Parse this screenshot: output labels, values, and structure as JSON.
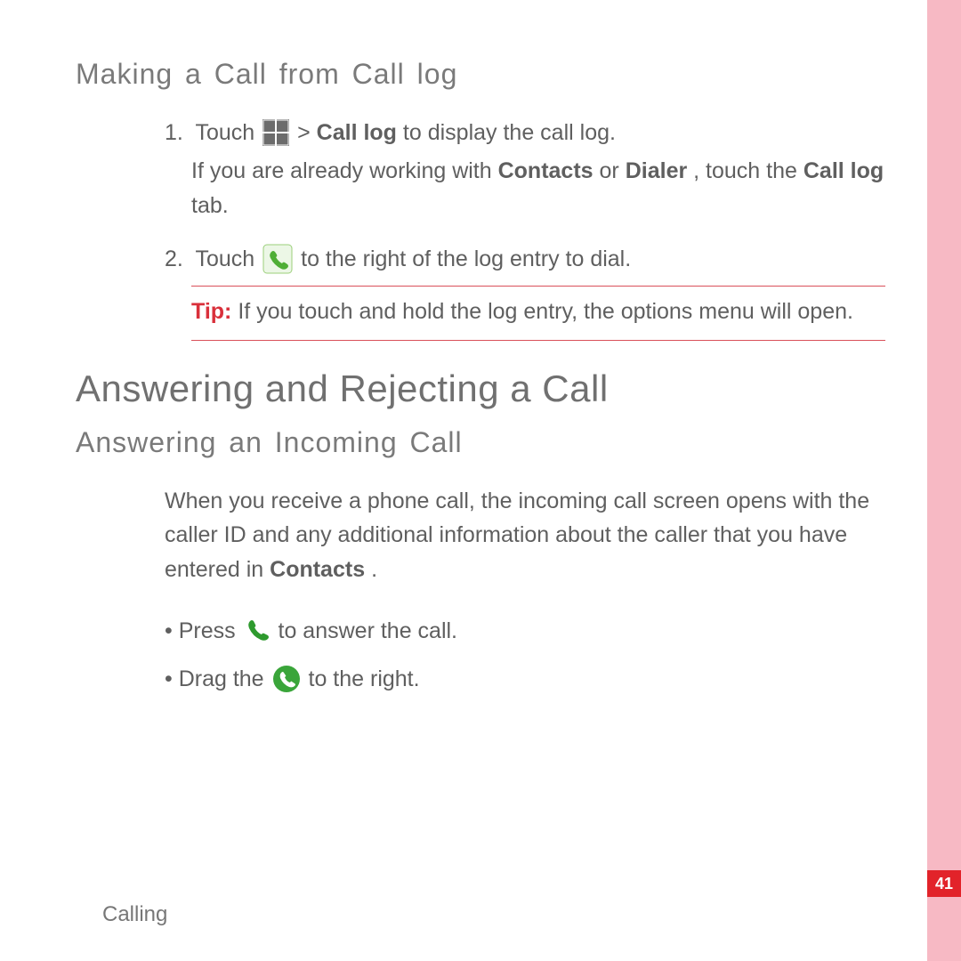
{
  "section1": {
    "title": "Making a Call from Call log",
    "step1_prefix": "1.",
    "step1_a": "Touch ",
    "step1_b": " > ",
    "step1_bold": "Call log",
    "step1_c": " to display the call log.",
    "step1_sub_a": "If you are already working with ",
    "step1_sub_bold1": "Contacts",
    "step1_sub_b": " or ",
    "step1_sub_bold2": "Dialer",
    "step1_sub_c": ", touch the ",
    "step1_sub_bold3": "Call log",
    "step1_sub_d": " tab.",
    "step2_prefix": "2.",
    "step2_a": "Touch ",
    "step2_b": " to the right of the log entry to dial.",
    "tip_label": "Tip:  ",
    "tip_text": "If you touch and hold the log entry, the options menu will open."
  },
  "section2": {
    "heading": "Answering and Rejecting a Call",
    "subheading": "Answering an Incoming Call",
    "para_a": "When you receive a phone call, the incoming call screen opens with the caller ID and any additional information about the caller that you have entered in ",
    "para_bold": "Contacts",
    "para_b": ".",
    "bullet1_a": "Press  ",
    "bullet1_b": "  to answer the call.",
    "bullet2_a": "Drag the  ",
    "bullet2_b": "  to the right."
  },
  "footer": {
    "chapter": "Calling",
    "page": "41"
  }
}
